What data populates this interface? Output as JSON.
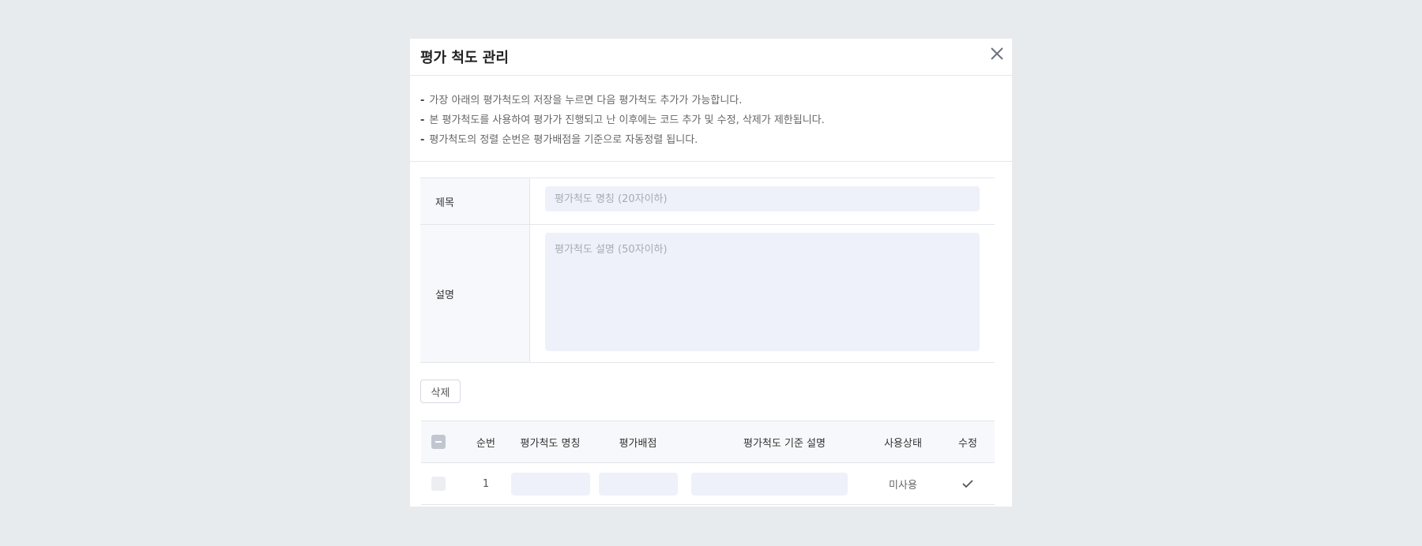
{
  "modal": {
    "title": "평가 척도 관리",
    "close_icon": "close-icon"
  },
  "notes": [
    "가장 아래의 평가척도의 저장을 누르면 다음 평가척도 추가가 가능합니다.",
    "본 평가척도를 사용하여 평가가 진행되고 난 이후에는 코드 추가 및 수정, 삭제가 제한됩니다.",
    "평가척도의 정렬 순번은 평가배점을 기준으로 자동정렬 됩니다."
  ],
  "note_bullet": "-",
  "form": {
    "title_label": "제목",
    "title_placeholder": "평가척도 명칭 (20자이하)",
    "desc_label": "설명",
    "desc_placeholder": "평가척도 설명 (50자이하)"
  },
  "delete_label": "삭제",
  "table": {
    "headers": [
      "순번",
      "평가척도 명칭",
      "평가배점",
      "평가척도 기준 설명",
      "사용상태",
      "수정"
    ],
    "rows": [
      {
        "seq": "1",
        "name": "",
        "score": "",
        "desc": "",
        "status": "미사용"
      }
    ]
  }
}
